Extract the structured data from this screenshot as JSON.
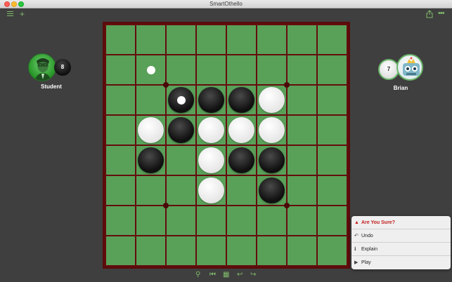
{
  "window": {
    "title": "SmartOthello"
  },
  "toolbar": {
    "menu_icon": "hamburger-menu-icon",
    "add_icon": "plus-icon",
    "add_glyph": "+",
    "share_icon": "share-icon",
    "more_icon": "ellipsis-icon",
    "more_glyph": "•••",
    "accent_color": "#7fb96a"
  },
  "board": {
    "size": 8,
    "colors": {
      "green": "#59a059",
      "lines": "#640d0d",
      "frame": "#5a0c0c"
    },
    "rows": [
      "........",
      "........",
      "..BBBW..",
      ".WBWWW..",
      ".B.WBB..",
      "...W.B..",
      "........",
      "........"
    ],
    "last_move": {
      "row": 2,
      "col": 2
    },
    "hints": [
      {
        "row": 1,
        "col": 1
      }
    ]
  },
  "players": {
    "left": {
      "name": "Student",
      "count": "8",
      "disc": "black",
      "avatar_icon": "student-avatar-icon"
    },
    "right": {
      "name": "Brian",
      "count": "7",
      "disc": "white",
      "avatar_icon": "robot-avatar-icon"
    }
  },
  "popover": {
    "items": [
      {
        "label": "Are You Sure?",
        "icon": "warning-icon",
        "glyph": "▲",
        "warning": true
      },
      {
        "label": "Undo",
        "icon": "undo-icon",
        "glyph": "↶"
      },
      {
        "label": "Explain",
        "icon": "info-icon",
        "glyph": "ℹ"
      },
      {
        "label": "Play",
        "icon": "play-icon",
        "glyph": "▶"
      }
    ]
  },
  "bottom_toolbar": [
    {
      "icon": "lightbulb-icon",
      "glyph": "⚲"
    },
    {
      "icon": "skip-back-icon",
      "glyph": "⏮"
    },
    {
      "icon": "board-grid-icon",
      "glyph": "▦"
    },
    {
      "icon": "undo-arrow-icon",
      "glyph": "↩"
    },
    {
      "icon": "redo-arrow-icon",
      "glyph": "↪"
    }
  ]
}
